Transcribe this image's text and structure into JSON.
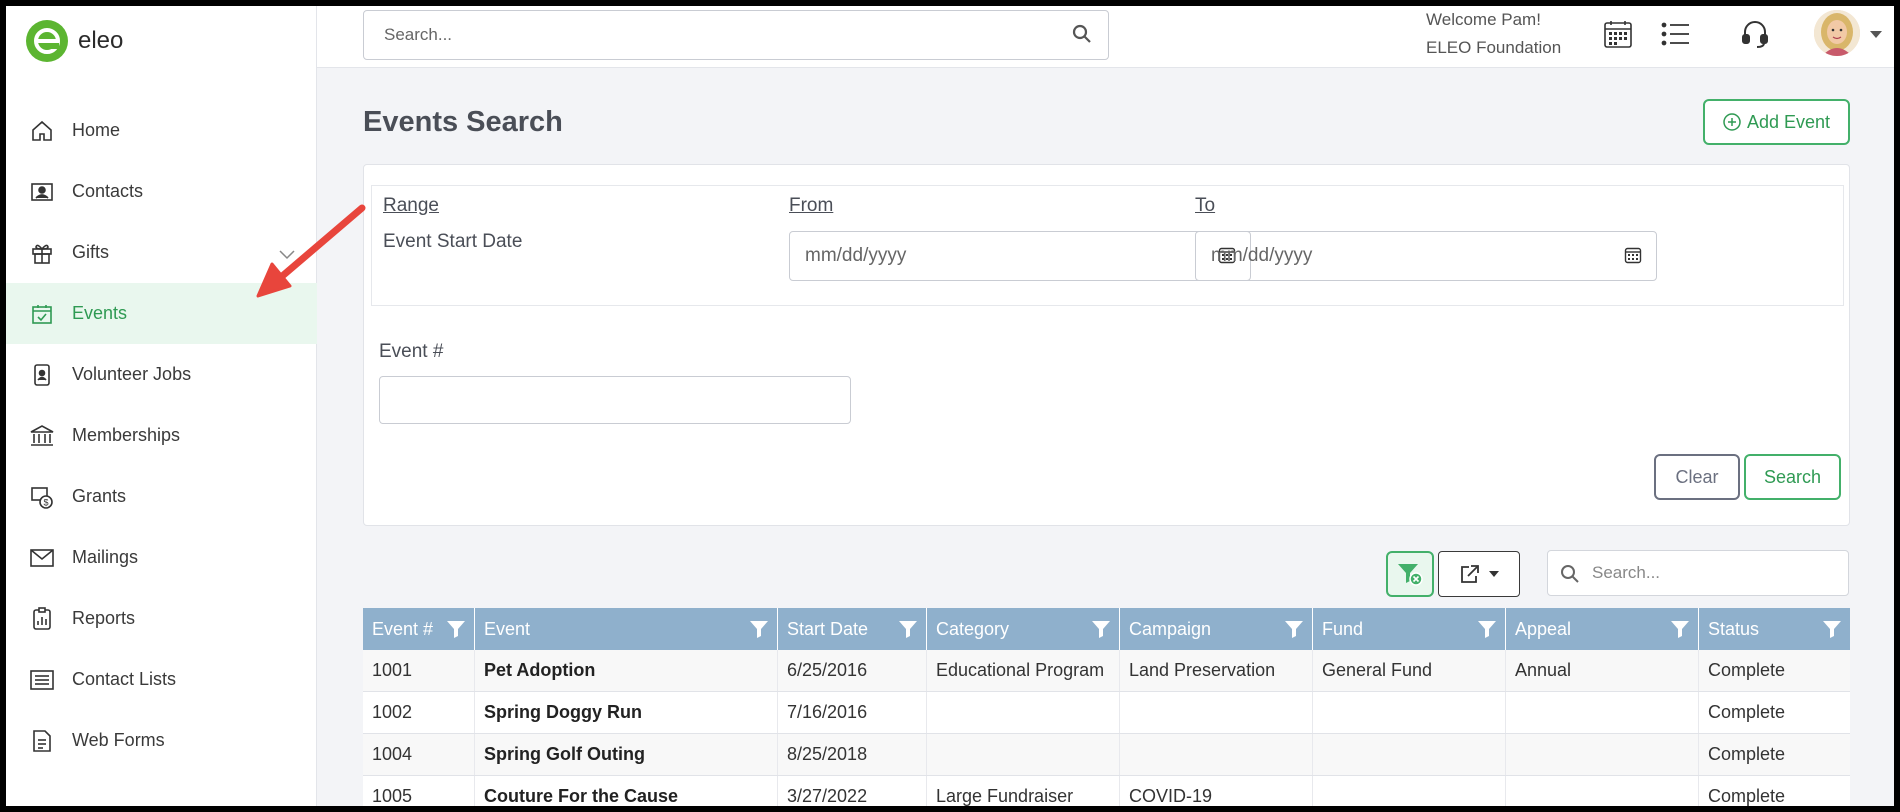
{
  "brand": {
    "name": "eleo",
    "color": "#5cb531"
  },
  "topbar": {
    "search_placeholder": "Search...",
    "welcome_line1": "Welcome Pam!",
    "welcome_line2": "ELEO Foundation",
    "icons": [
      "calendar-icon",
      "list-icon",
      "headset-icon",
      "avatar"
    ]
  },
  "sidebar": {
    "items": [
      {
        "label": "Home",
        "icon": "home-icon"
      },
      {
        "label": "Contacts",
        "icon": "contacts-icon"
      },
      {
        "label": "Gifts",
        "icon": "gift-icon",
        "expandable": true
      },
      {
        "label": "Events",
        "icon": "calendar-check-icon",
        "active": true
      },
      {
        "label": "Volunteer Jobs",
        "icon": "badge-icon"
      },
      {
        "label": "Memberships",
        "icon": "institution-icon"
      },
      {
        "label": "Grants",
        "icon": "grant-icon"
      },
      {
        "label": "Mailings",
        "icon": "envelope-icon"
      },
      {
        "label": "Reports",
        "icon": "report-icon"
      },
      {
        "label": "Contact Lists",
        "icon": "list-box-icon"
      },
      {
        "label": "Web Forms",
        "icon": "form-icon"
      }
    ]
  },
  "page": {
    "title": "Events Search",
    "add_button": "Add Event"
  },
  "filters": {
    "range_label": "Range",
    "range_value": "Event Start Date",
    "from_label": "From",
    "to_label": "To",
    "from_placeholder": "mm/dd/yyyy",
    "to_placeholder": "mm/dd/yyyy",
    "event_num_label": "Event #",
    "event_num_value": "",
    "clear_label": "Clear",
    "search_label": "Search"
  },
  "grid": {
    "search_placeholder": "Search...",
    "columns": [
      "Event #",
      "Event",
      "Start Date",
      "Category",
      "Campaign",
      "Fund",
      "Appeal",
      "Status"
    ],
    "rows": [
      [
        "1001",
        "Pet Adoption",
        "6/25/2016",
        "Educational Program",
        "Land Preservation",
        "General Fund",
        "Annual",
        "Complete"
      ],
      [
        "1002",
        "Spring Doggy Run",
        "7/16/2016",
        "",
        "",
        "",
        "",
        "Complete"
      ],
      [
        "1004",
        "Spring Golf Outing",
        "8/25/2018",
        "",
        "",
        "",
        "",
        "Complete"
      ],
      [
        "1005",
        "Couture For the Cause",
        "3/27/2022",
        "Large Fundraiser",
        "COVID-19",
        "",
        "",
        "Complete"
      ]
    ]
  },
  "colors": {
    "accent": "#43b06a",
    "active_bg": "#e9f7ee",
    "grid_header": "#8fb0cc",
    "annotation_arrow": "#e8453c"
  }
}
